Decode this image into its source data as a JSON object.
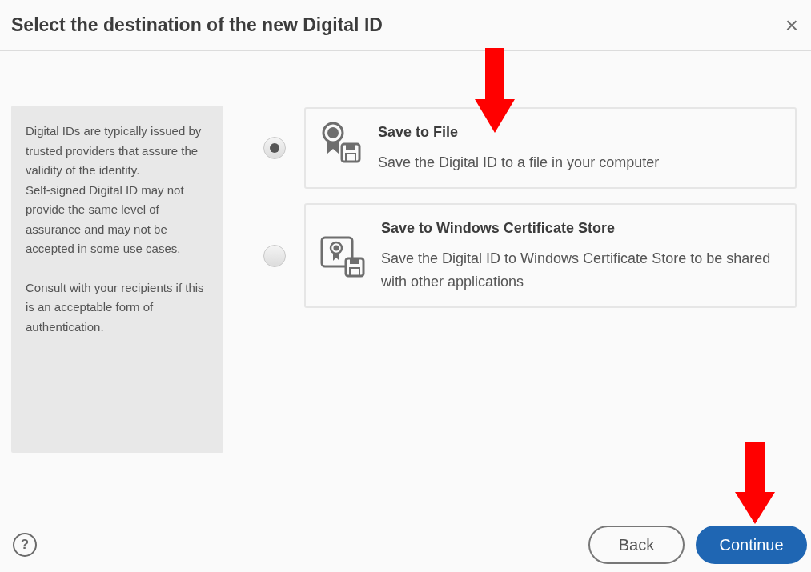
{
  "dialog": {
    "title": "Select the destination of the new Digital ID",
    "close": "×"
  },
  "info_panel": {
    "groups": [
      [
        "Digital IDs are typically issued by trusted providers that assure the validity of the identity.",
        "Self-signed Digital ID may not provide the same level of assurance and may not be accepted in some use cases."
      ],
      [
        "Consult with your recipients if this is an acceptable form of authentication."
      ]
    ]
  },
  "options": [
    {
      "kind": "file",
      "title": "Save to File",
      "description": "Save the Digital ID to a file in your computer",
      "selected": true
    },
    {
      "kind": "store",
      "title": "Save to Windows Certificate Store",
      "description": "Save the Digital ID to Windows Certificate Store to be shared with other applications",
      "selected": false
    }
  ],
  "footer": {
    "help": "?",
    "buttons": [
      {
        "kind": "secondary",
        "label": "Back"
      },
      {
        "kind": "primary",
        "label": "Continue"
      }
    ]
  }
}
